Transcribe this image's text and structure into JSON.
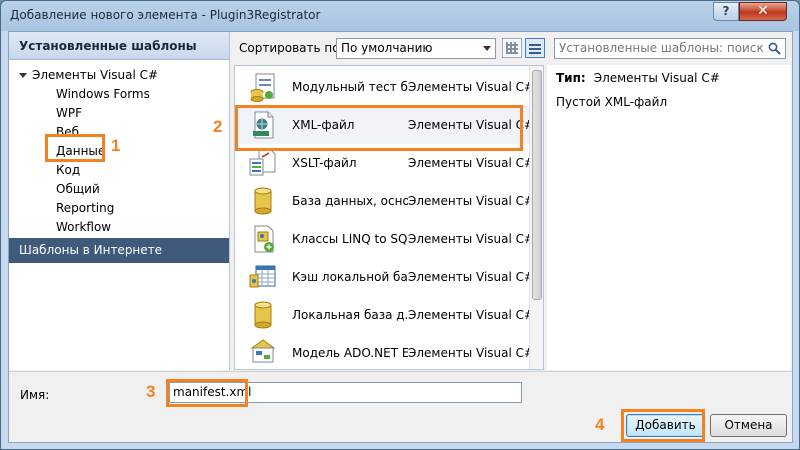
{
  "window": {
    "title": "Добавление нового элемента - Plugin3Registrator",
    "help_label": "?",
    "close_label": "✕"
  },
  "sidebar": {
    "installed_header": "Установленные шаблоны",
    "root_label": "Элементы Visual C#",
    "items": [
      {
        "label": "Windows Forms"
      },
      {
        "label": "WPF"
      },
      {
        "label": "Веб"
      },
      {
        "label": "Данные"
      },
      {
        "label": "Код"
      },
      {
        "label": "Общий"
      },
      {
        "label": "Reporting"
      },
      {
        "label": "Workflow"
      }
    ],
    "online_header": "Шаблоны в Интернете"
  },
  "toolbar": {
    "sort_label": "Сортировать по:",
    "sort_value": "По умолчанию",
    "search_placeholder": "Установленные шаблоны: поиск"
  },
  "templates": [
    {
      "name": "Модульный тест б...",
      "category": "Элементы Visual C#",
      "icon": "unit-test-icon"
    },
    {
      "name": "XML-файл",
      "category": "Элементы Visual C#",
      "icon": "xml-file-icon"
    },
    {
      "name": "XSLT-файл",
      "category": "Элементы Visual C#",
      "icon": "xslt-file-icon"
    },
    {
      "name": "База данных, основ...",
      "category": "Элементы Visual C#",
      "icon": "database-icon"
    },
    {
      "name": "Классы LINQ to SQL",
      "category": "Элементы Visual C#",
      "icon": "linq-to-sql-icon"
    },
    {
      "name": "Кэш локальной ба...",
      "category": "Элементы Visual C#",
      "icon": "local-cache-icon"
    },
    {
      "name": "Локальная база д...",
      "category": "Элементы Visual C#",
      "icon": "local-database-icon"
    },
    {
      "name": "Модель ADO.NET E...",
      "category": "Элементы Visual C#",
      "icon": "ado-net-model-icon"
    }
  ],
  "details": {
    "type_label": "Тип:",
    "type_value": "Элементы Visual C#",
    "description": "Пустой XML-файл"
  },
  "footer": {
    "name_label": "Имя:",
    "name_value": "manifest.xml",
    "add_label": "Добавить",
    "cancel_label": "Отмена"
  },
  "annotations": [
    "1",
    "2",
    "3",
    "4"
  ],
  "colors": {
    "highlight": "#f58220",
    "online_header_bg": "#3f5a7a",
    "title_gradient": "#b9d1ea"
  }
}
